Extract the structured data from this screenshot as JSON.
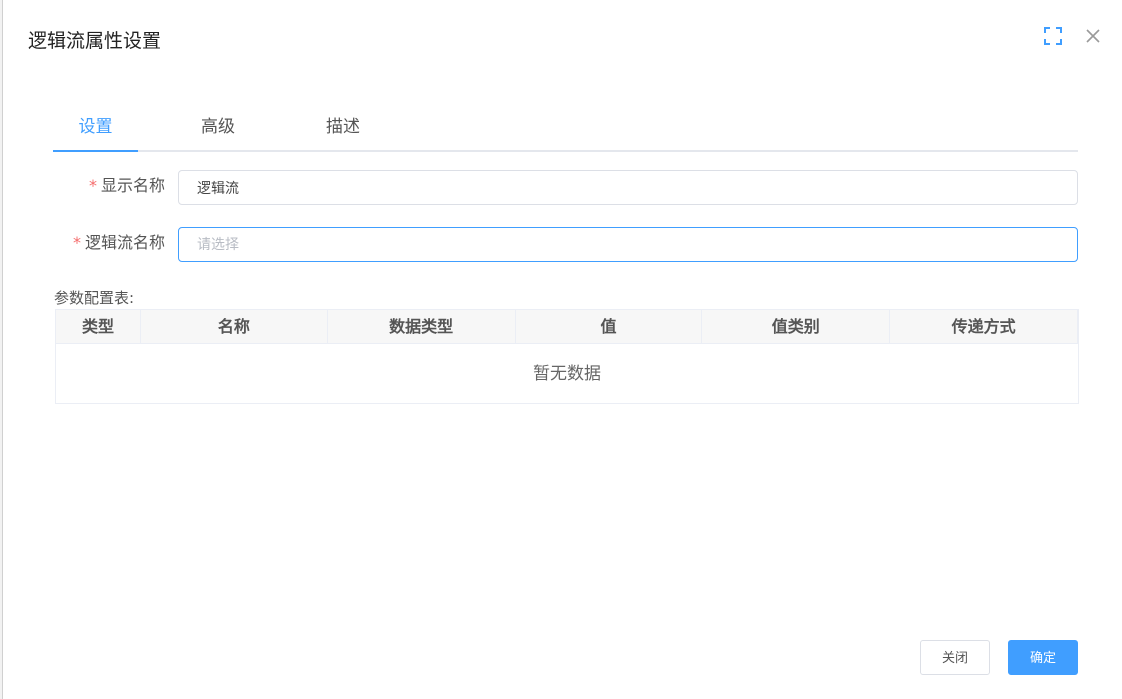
{
  "dialog": {
    "title": "逻辑流属性设置",
    "icons": {
      "fullscreen": "fullscreen-icon",
      "close": "close-icon"
    }
  },
  "tabs": [
    {
      "label": "设置",
      "active": true
    },
    {
      "label": "高级",
      "active": false
    },
    {
      "label": "描述",
      "active": false
    }
  ],
  "form": {
    "required_mark": "*",
    "display_name": {
      "label": "显示名称",
      "value": "逻辑流"
    },
    "flow_name": {
      "label": "逻辑流名称",
      "value": "",
      "placeholder": "请选择"
    }
  },
  "params_table": {
    "label": "参数配置表:",
    "columns": [
      "类型",
      "名称",
      "数据类型",
      "值",
      "值类别",
      "传递方式"
    ],
    "rows": [],
    "empty_text": "暂无数据"
  },
  "footer": {
    "cancel_label": "关闭",
    "ok_label": "确定"
  },
  "colors": {
    "primary": "#409eff",
    "required": "#f56c6c",
    "border": "#dcdfe6"
  }
}
